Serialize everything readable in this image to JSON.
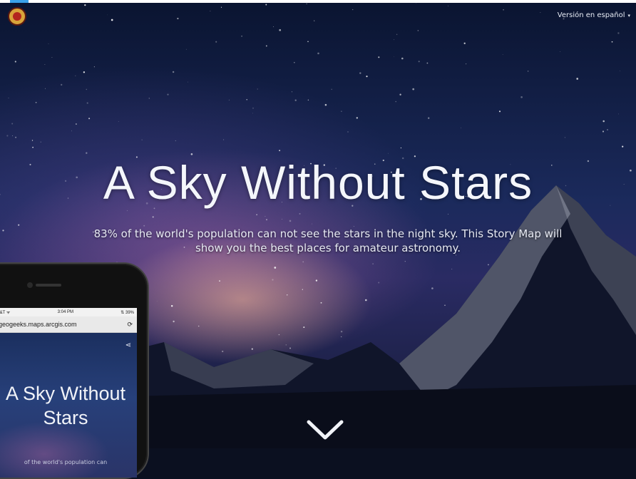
{
  "header": {
    "logo_icon": "astronomy-logo-icon",
    "language_link": "Versión en español",
    "language_caret": "▾"
  },
  "hero": {
    "title": "A Sky Without Stars",
    "subtitle": "83% of the world's population can not see the stars in the night sky. This Story Map will show you the best places for amateur astronomy."
  },
  "scroll_icon": "chevron-down-icon",
  "phone": {
    "status_left": "T&T ᯤ",
    "status_time": "3:04 PM",
    "status_right": "⇅ 39%",
    "url": "geogeeks.maps.arcgis.com",
    "refresh_icon": "⟳",
    "share_icon": "⋖",
    "title": "A Sky Without Stars",
    "subtitle": "of the world's population can"
  },
  "colors": {
    "accent": "#3aa1e8",
    "title_text": "#f4f6fb",
    "sky_dark": "#0a1430"
  }
}
